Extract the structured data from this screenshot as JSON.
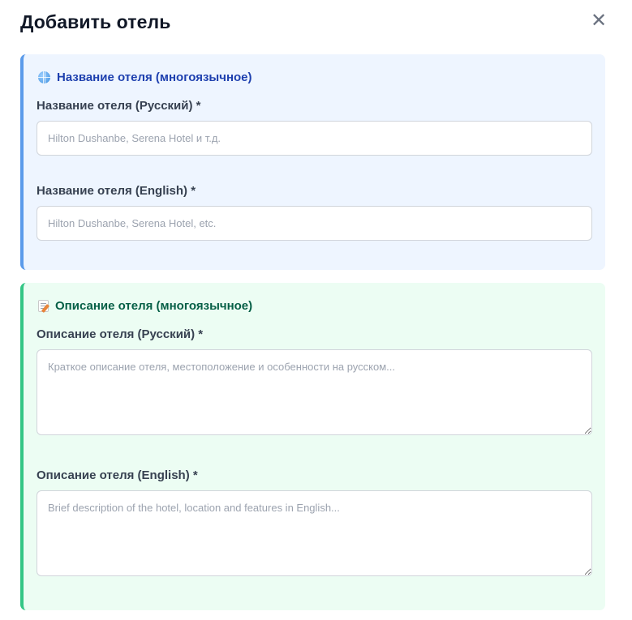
{
  "modal": {
    "title": "Добавить отель",
    "close_symbol": "✕"
  },
  "name_section": {
    "heading": "Название отеля (многоязычное)",
    "icon": "globe-icon",
    "accent_color": "#5b9bea",
    "background_color": "#eef5ff",
    "ru": {
      "label": "Название отеля (Русский) *",
      "placeholder": "Hilton Dushanbe, Serena Hotel и т.д.",
      "value": ""
    },
    "en": {
      "label": "Название отеля (English) *",
      "placeholder": "Hilton Dushanbe, Serena Hotel, etc.",
      "value": ""
    }
  },
  "description_section": {
    "heading": "Описание отеля (многоязычное)",
    "icon": "memo-icon",
    "accent_color": "#34c685",
    "background_color": "#ecfdf3",
    "ru": {
      "label": "Описание отеля (Русский) *",
      "placeholder": "Краткое описание отеля, местоположение и особенности на русском...",
      "value": ""
    },
    "en": {
      "label": "Описание отеля (English) *",
      "placeholder": "Brief description of the hotel, location and features in English...",
      "value": ""
    }
  }
}
